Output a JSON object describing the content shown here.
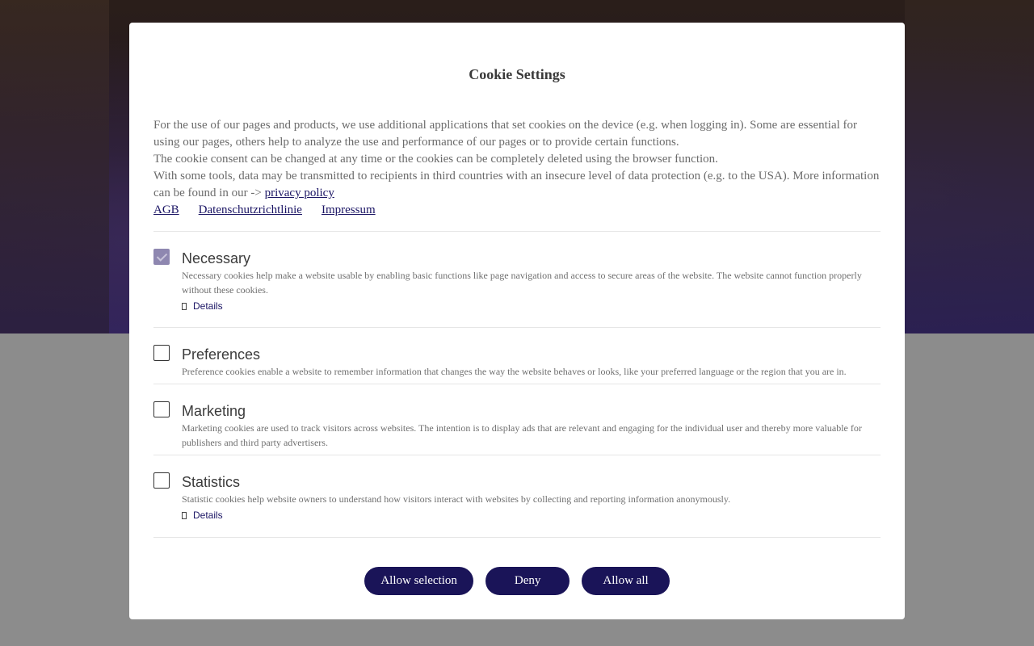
{
  "modal": {
    "title": "Cookie Settings",
    "intro": {
      "p1": "For the use of our pages and products, we use additional applications that set cookies on the device (e.g. when logging in). Some are essential for using our pages, others help to analyze the use and performance of our pages or to provide certain functions.",
      "p2": "The cookie consent can be changed at any time or the cookies can be completely deleted using the browser function.",
      "p3_prefix": "With some tools, data may be transmitted to recipients in third countries with an insecure level of data protection (e.g. to the USA). More information can be found in our -> ",
      "privacy_link": "privacy policy"
    },
    "links": [
      "AGB",
      "Datenschutzrichtlinie",
      "Impressum"
    ],
    "sections": [
      {
        "title": "Necessary",
        "checked": true,
        "description": "Necessary cookies help make a website usable by enabling basic functions like page navigation and access to secure areas of the website. The website cannot function properly without these cookies.",
        "details_label": "Details"
      },
      {
        "title": "Preferences",
        "checked": false,
        "description": "Preference cookies enable a website to remember information that changes the way the website behaves or looks, like your preferred language or the region that you are in."
      },
      {
        "title": "Marketing",
        "checked": false,
        "description": "Marketing cookies are used to track visitors across websites. The intention is to display ads that are relevant and engaging for the individual user and thereby more valuable for publishers and third party advertisers."
      },
      {
        "title": "Statistics",
        "checked": false,
        "description": "Statistic cookies help website owners to understand how visitors interact with websites by collecting and reporting information anonymously.",
        "details_label": "Details"
      }
    ],
    "buttons": {
      "allow_selection": "Allow selection",
      "deny": "Deny",
      "allow_all": "Allow all"
    }
  },
  "colors": {
    "accent": "#1a1458",
    "checkbox_checked": "#8e87b0",
    "link": "#1a1464"
  }
}
